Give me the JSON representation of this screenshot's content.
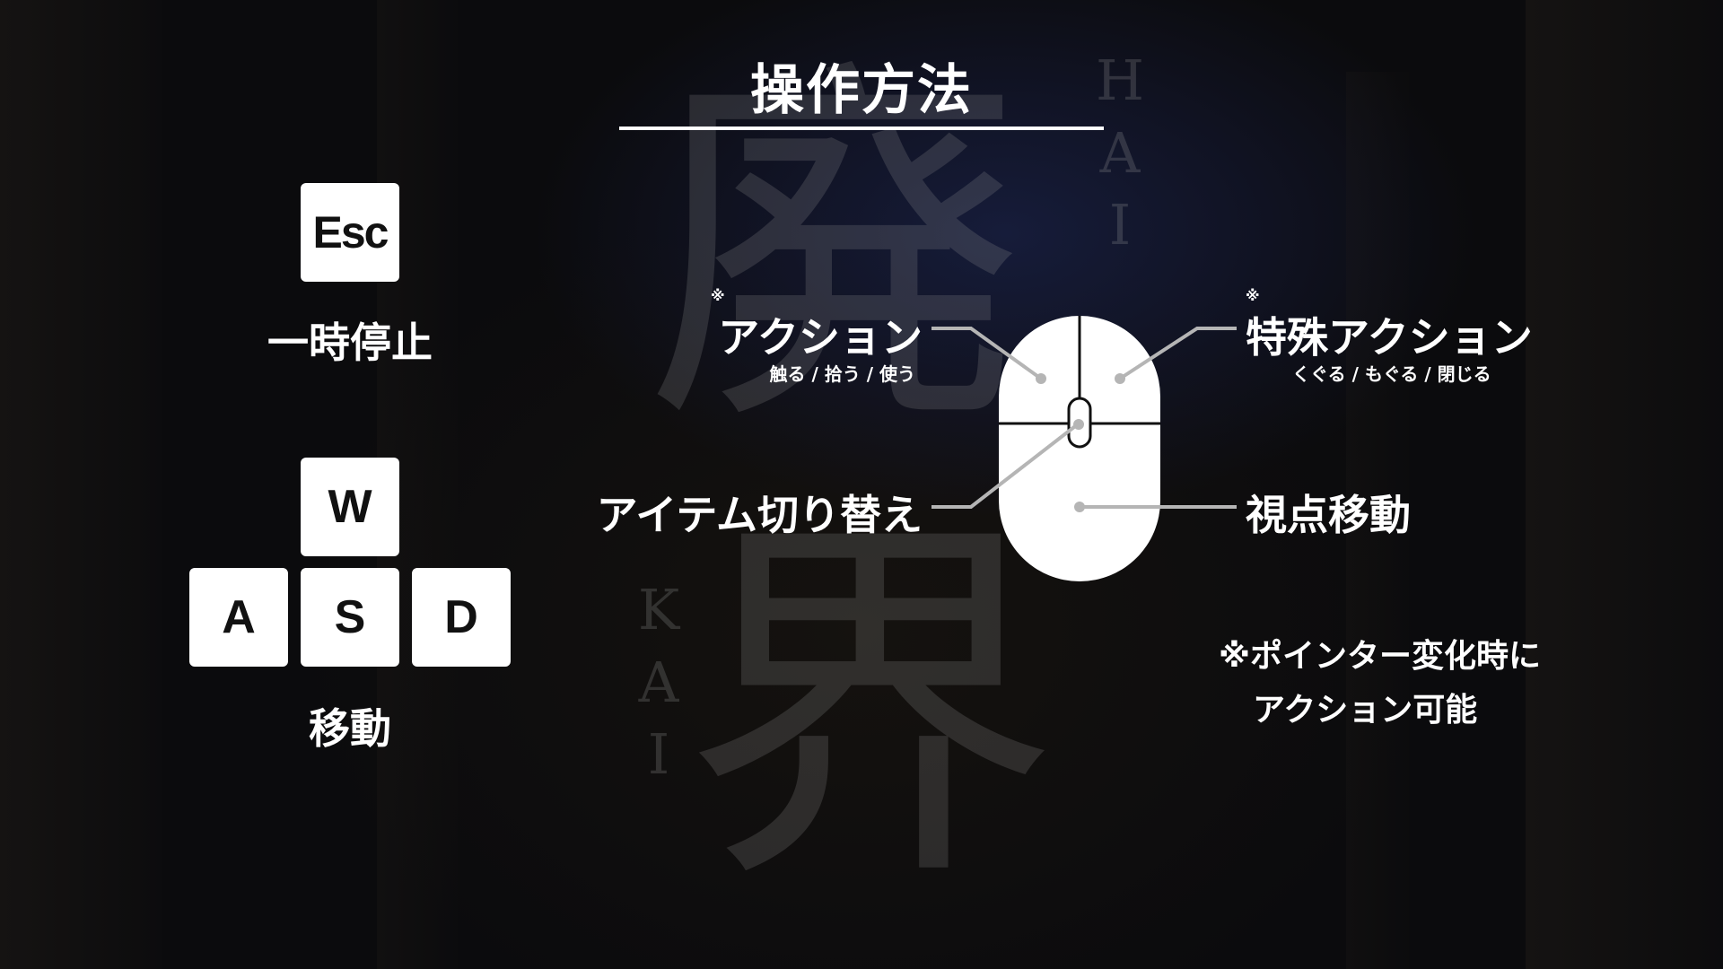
{
  "screen": {
    "title": "操作方法"
  },
  "background": {
    "kanji_top": "廃",
    "kanji_bottom": "界",
    "roman_top": [
      "H",
      "A",
      "I"
    ],
    "roman_bottom": [
      "K",
      "A",
      "I"
    ]
  },
  "keyboard": {
    "esc_key": "Esc",
    "pause_label": "一時停止",
    "w_key": "W",
    "a_key": "A",
    "s_key": "S",
    "d_key": "D",
    "move_label": "移動"
  },
  "mouse": {
    "left_click": {
      "mark": "※",
      "label": "アクション",
      "sub": "触る / 拾う / 使う"
    },
    "right_click": {
      "mark": "※",
      "label": "特殊アクション",
      "sub": "くぐる / もぐる / 閉じる"
    },
    "wheel": {
      "label": "アイテム切り替え"
    },
    "move": {
      "label": "視点移動"
    },
    "note_line1": "※ポインター変化時に",
    "note_line2": "アクション可能"
  },
  "colors": {
    "text": "#ffffff",
    "key_face": "#ffffff",
    "connector": "#b5b5b5",
    "background": "#0b0c10"
  }
}
